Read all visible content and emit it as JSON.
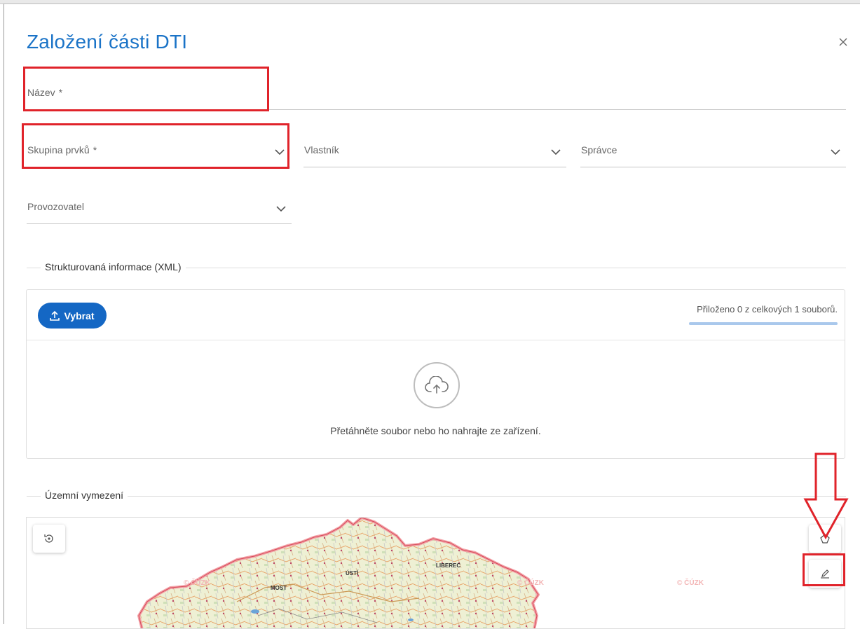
{
  "dialog": {
    "title": "Založení části DTI",
    "close_icon": "close-icon"
  },
  "form": {
    "name": {
      "label": "Název",
      "required_mark": "*"
    },
    "element_group": {
      "label": "Skupina prvků",
      "required_mark": "*"
    },
    "owner": {
      "label": "Vlastník"
    },
    "administrator": {
      "label": "Správce"
    },
    "operator": {
      "label": "Provozovatel"
    }
  },
  "structured_info": {
    "legend": "Strukturovaná informace (XML)",
    "select_button_label": "Vybrat",
    "attached_status": "Přiloženo 0 z celkových 1 souborů.",
    "attached_count": 0,
    "total_count": 1,
    "drop_text": "Přetáhněte soubor nebo ho nahrajte ze zařízení."
  },
  "territory": {
    "legend": "Územní vymezení",
    "map": {
      "watermark": "© ČÚZK",
      "city_labels": [
        "LIBEREC",
        "MOST",
        "ÚSTÍ"
      ]
    },
    "controls": [
      "reset-view-icon",
      "polygon-icon",
      "edit-draw-icon"
    ]
  },
  "colors": {
    "title": "#1a73c7",
    "primary_button": "#1467c4",
    "highlight": "#e0232a",
    "progress": "#a9c8ec"
  }
}
